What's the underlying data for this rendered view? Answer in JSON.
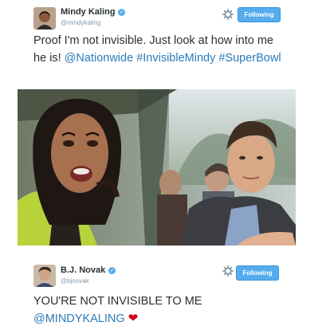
{
  "tweet1": {
    "display_name": "Mindy Kaling",
    "handle": "@mindykaling",
    "follow_label": "Following",
    "text_prefix": "Proof I'm not invisible. Just look at how into me he is!",
    "mention": "@Nationwide",
    "hashtag1": "#InvisibleMindy",
    "hashtag2": "#SuperBowl",
    "icons": {
      "verified": "verified-badge-icon",
      "settings": "gear-icon"
    }
  },
  "tweet2": {
    "display_name": "B.J. Novak",
    "handle": "@bjnovak",
    "follow_label": "Following",
    "text_line1": "YOU'RE NOT INVISIBLE TO ME",
    "mention": "@MINDYKALING",
    "heart": "❤",
    "icons": {
      "verified": "verified-badge-icon",
      "settings": "gear-icon"
    }
  },
  "colors": {
    "accent": "#55acee",
    "link": "#2b7bb9",
    "heart": "#d0021b",
    "muted": "#8899a6"
  }
}
